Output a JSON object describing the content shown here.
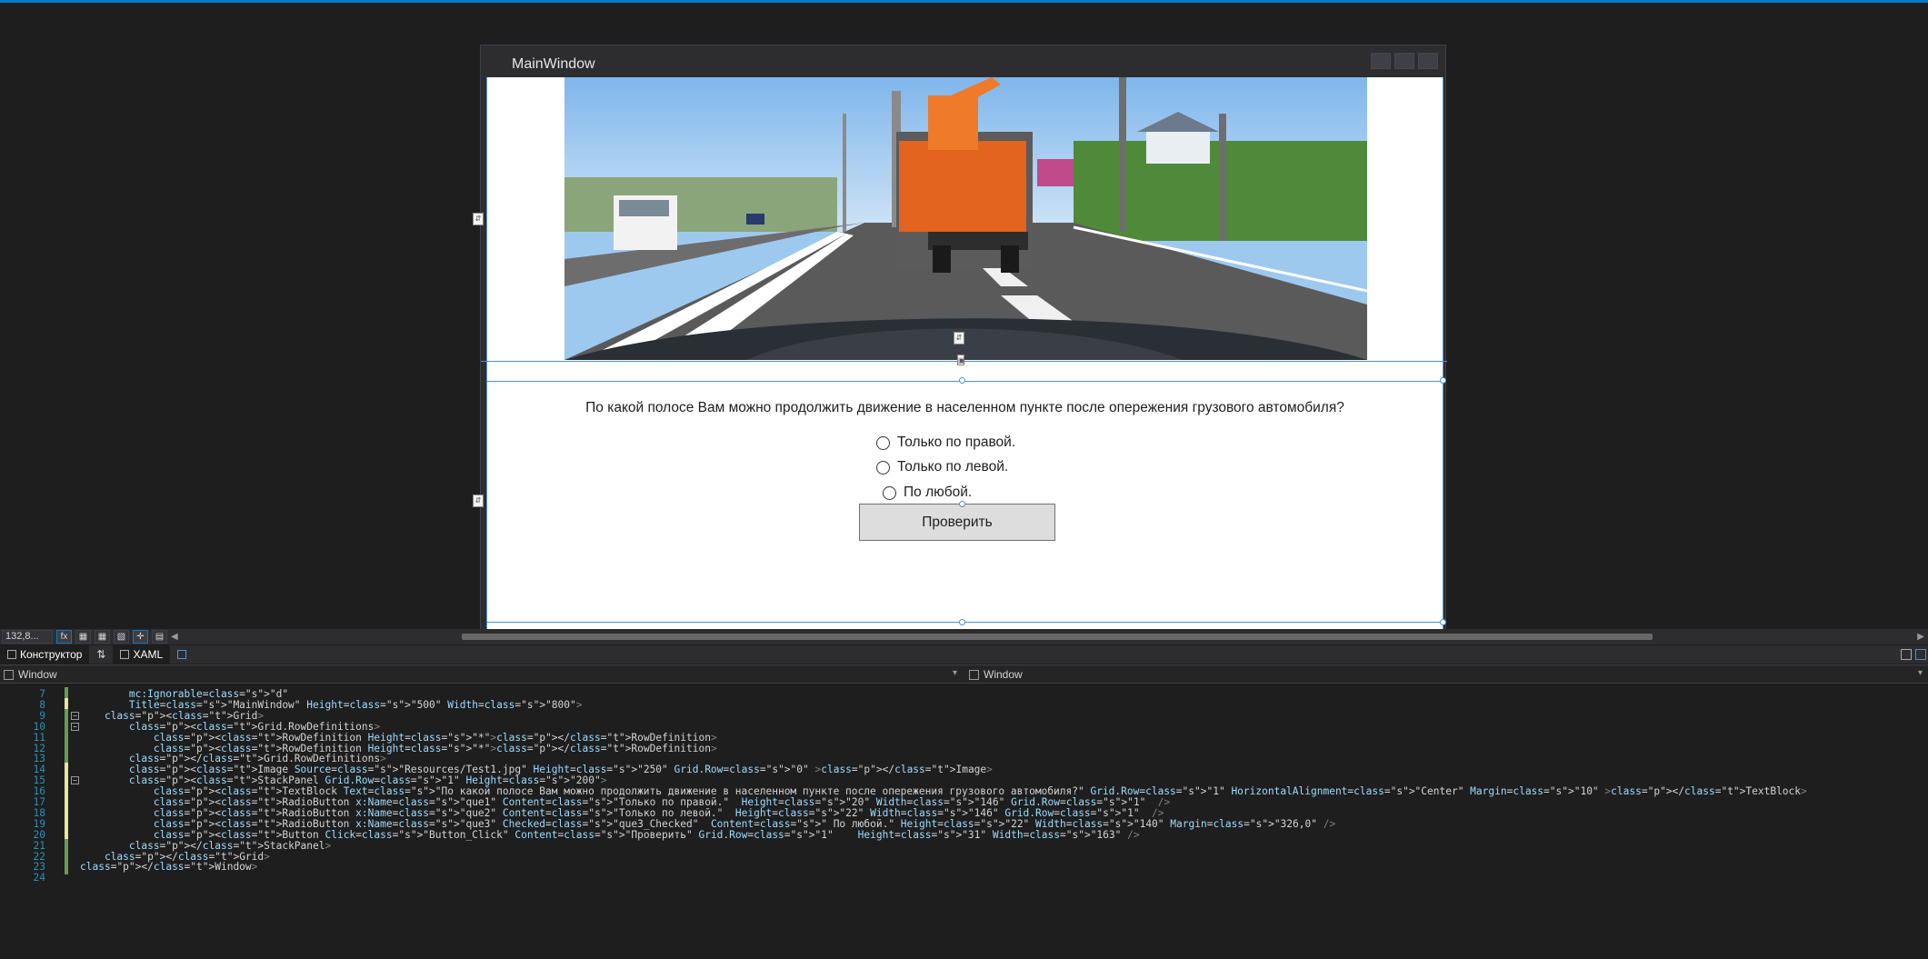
{
  "designer": {
    "window_title": "MainWindow",
    "question": "По какой полосе Вам можно продолжить движение в населенном пункте после опережения грузового автомобиля?",
    "radios": [
      {
        "label": "Только по правой."
      },
      {
        "label": "Только по левой."
      },
      {
        "label": "По любой."
      }
    ],
    "check_button": "Проверить"
  },
  "toolbar": {
    "zoom": "132,8..."
  },
  "tabs": {
    "designer": "Конструктор",
    "swap": "⇅",
    "xaml": "XAML"
  },
  "nav": {
    "left": "Window",
    "right": "Window"
  },
  "code": {
    "lines": [
      {
        "num": "7",
        "text": "        mc:Ignorable=\"d\""
      },
      {
        "num": "8",
        "text": "        Title=\"MainWindow\" Height=\"500\" Width=\"800\">"
      },
      {
        "num": "9",
        "text": "    <Grid>"
      },
      {
        "num": "10",
        "text": "        <Grid.RowDefinitions>"
      },
      {
        "num": "11",
        "text": "            <RowDefinition Height=\"*\"></RowDefinition>"
      },
      {
        "num": "12",
        "text": "            <RowDefinition Height=\"*\"></RowDefinition>"
      },
      {
        "num": "13",
        "text": "        </Grid.RowDefinitions>"
      },
      {
        "num": "14",
        "text": "        <Image Source=\"Resources/Test1.jpg\" Height=\"250\" Grid.Row=\"0\" ></Image>"
      },
      {
        "num": "15",
        "text": "        <StackPanel Grid.Row=\"1\" Height=\"200\">"
      },
      {
        "num": "16",
        "text": "            <TextBlock Text=\"По какой полосе Вам можно продолжить движение в населенном пункте после опережения грузового автомобиля?\" Grid.Row=\"1\" HorizontalAlignment=\"Center\" Margin=\"10\" ></TextBlock>"
      },
      {
        "num": "17",
        "text": "            <RadioButton x:Name=\"que1\" Content=\"Только по правой.\"  Height=\"20\" Width=\"146\" Grid.Row=\"1\"  />"
      },
      {
        "num": "18",
        "text": "            <RadioButton x:Name=\"que2\" Content=\"Только по левой.\"  Height=\"22\" Width=\"146\" Grid.Row=\"1\"  />"
      },
      {
        "num": "19",
        "text": "            <RadioButton x:Name=\"que3\" Checked=\"que3_Checked\"  Content=\" По любой.\" Height=\"22\" Width=\"140\" Margin=\"326,0\" />"
      },
      {
        "num": "20",
        "text": "            <Button Click=\"Button_Click\" Content=\"Проверить\" Grid.Row=\"1\"    Height=\"31\" Width=\"163\" />"
      },
      {
        "num": "21",
        "text": "        </StackPanel>"
      },
      {
        "num": "22",
        "text": "    </Grid>"
      },
      {
        "num": "23",
        "text": "</Window>"
      },
      {
        "num": "24",
        "text": ""
      }
    ]
  },
  "colors": {
    "accent": "#007acc",
    "selection": "#4a90e2",
    "editor_bg": "#1e1e1e"
  }
}
